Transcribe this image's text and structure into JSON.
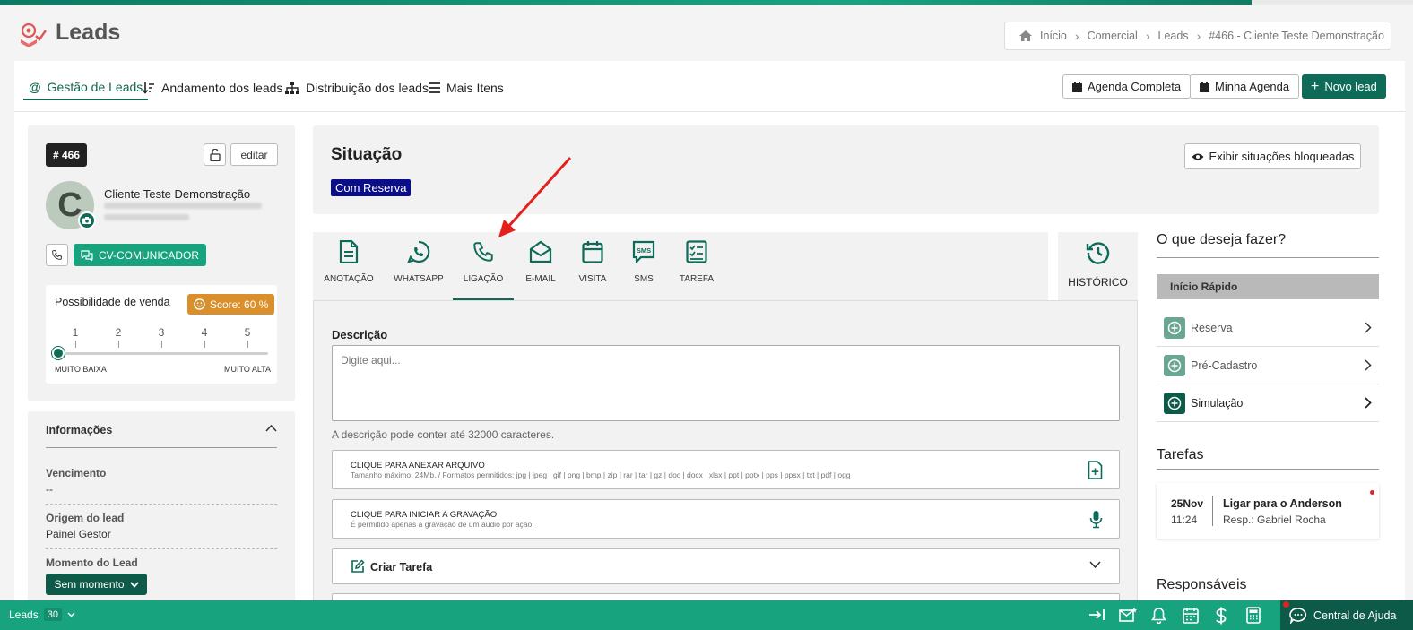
{
  "app": {
    "title": "Leads"
  },
  "breadcrumb": [
    "Início",
    "Comercial",
    "Leads",
    "#466 - Cliente Teste Demonstração"
  ],
  "nav": {
    "tabs": [
      {
        "label": "Gestão de Leads",
        "icon": "at-icon"
      },
      {
        "label": "Andamento dos leads",
        "icon": "sort-icon"
      },
      {
        "label": "Distribuição dos leads",
        "icon": "sitemap-icon"
      },
      {
        "label": "Mais Itens",
        "icon": "menu-icon"
      }
    ],
    "active_tab": 0,
    "buttons": {
      "agenda_completa": "Agenda Completa",
      "minha_agenda": "Minha Agenda",
      "novo_lead": "Novo lead"
    }
  },
  "lead": {
    "id": "# 466",
    "edit_label": "editar",
    "avatar_letter": "C",
    "name": "Cliente Teste Demonstração",
    "cv_button": "CV-COMUNICADOR"
  },
  "possibility": {
    "label": "Possibilidade de venda",
    "score": "Score: 60 %",
    "scale": [
      "1",
      "2",
      "3",
      "4",
      "5"
    ],
    "min_label": "MUITO BAIXA",
    "max_label": "MUITO ALTA",
    "current_level": 0
  },
  "info": {
    "title": "Informações",
    "fields": [
      {
        "key": "Vencimento",
        "value": "--"
      },
      {
        "key": "Origem do lead",
        "value": "Painel Gestor"
      },
      {
        "key": "Momento do Lead",
        "value": ""
      }
    ],
    "moment_button": "Sem momento"
  },
  "situation": {
    "title": "Situação",
    "badge": "Com Reserva",
    "blocked_button": "Exibir situações bloqueadas"
  },
  "actions": {
    "items": [
      {
        "label": "ANOTAÇÃO",
        "icon": "note-icon"
      },
      {
        "label": "WHATSAPP",
        "icon": "whatsapp-icon"
      },
      {
        "label": "LIGAÇÃO",
        "icon": "phone-icon"
      },
      {
        "label": "E-MAIL",
        "icon": "envelope-icon"
      },
      {
        "label": "VISITA",
        "icon": "calendar-icon"
      },
      {
        "label": "SMS",
        "icon": "sms-icon"
      },
      {
        "label": "TAREFA",
        "icon": "checklist-icon"
      }
    ],
    "active": 2,
    "history": "HISTÓRICO"
  },
  "form": {
    "description_label": "Descrição",
    "description_placeholder": "Digite aqui...",
    "description_help": "A descrição pode conter até 32000 caracteres.",
    "attach_title": "CLIQUE PARA ANEXAR ARQUIVO",
    "attach_subtitle": "Tamanho máximo: 24Mb. / Formatos permitidos: jpg | jpeg | gif | png | bmp | zip | rar | tar | gz | doc | docx | xlsx | ppt | pptx | pps | ppsx | txt | pdf | ogg",
    "record_title": "CLIQUE PARA INICIAR A GRAVAÇÃO",
    "record_subtitle": "É permitido apenas a gravação de um áudio por ação.",
    "create_task": "Criar Tarefa"
  },
  "right": {
    "question": "O que deseja fazer?",
    "quick_start": "Início Rápido",
    "quick_items": [
      "Reserva",
      "Pré-Cadastro",
      "Simulação"
    ],
    "tasks_title": "Tarefas",
    "task": {
      "date": "25Nov",
      "time": "11:24",
      "title": "Ligar para o Anderson",
      "resp": "Resp.: Gabriel Rocha"
    },
    "responsaveis_title": "Responsáveis"
  },
  "footer": {
    "label": "Leads",
    "count": "30",
    "help": "Central de Ajuda"
  },
  "colors": {
    "primary": "#0d6b57",
    "accent": "#17a37d",
    "badge_blue": "#0b0e8a",
    "score": "#d98f2b"
  }
}
